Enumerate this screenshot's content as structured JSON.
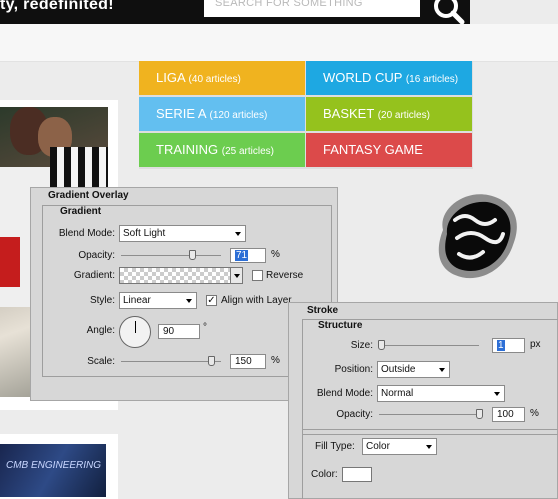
{
  "header": {
    "tagline": "ty, redefinited!",
    "search_placeholder": "SEARCH FOR SOMETHING"
  },
  "categories": [
    {
      "name": "LIGA",
      "count": "(40 articles)",
      "color": "#f0b31f"
    },
    {
      "name": "WORLD CUP",
      "count": "(16 articles)",
      "color": "#1ea8e2"
    },
    {
      "name": "SERIE A",
      "count": "(120 articles)",
      "color": "#63bff0"
    },
    {
      "name": "BASKET",
      "count": "(20 articles)",
      "color": "#95c21d"
    },
    {
      "name": "TRAINING",
      "count": "(25 articles)",
      "color": "#6ccd4f"
    },
    {
      "name": "FANTASY GAME",
      "count": "",
      "color": "#dc4a4a"
    }
  ],
  "thumb2_text": "CMB ENGINEERING",
  "gradient_overlay": {
    "title": "Gradient Overlay",
    "group": "Gradient",
    "blend_mode_label": "Blend Mode:",
    "blend_mode": "Soft Light",
    "opacity_label": "Opacity:",
    "opacity": "71",
    "opacity_fraction": 0.71,
    "percent": "%",
    "gradient_label": "Gradient:",
    "reverse_label": "Reverse",
    "reverse_checked": false,
    "style_label": "Style:",
    "style": "Linear",
    "align_label": "Align with Layer",
    "align_checked": true,
    "check_mark": "✓",
    "angle_label": "Angle:",
    "angle": "90",
    "degree": "°",
    "scale_label": "Scale:",
    "scale": "150",
    "scale_fraction": 0.9
  },
  "stroke": {
    "title": "Stroke",
    "group": "Structure",
    "size_label": "Size:",
    "size": "1",
    "size_fraction": 0.02,
    "px": "px",
    "position_label": "Position:",
    "position": "Outside",
    "blend_mode_label": "Blend Mode:",
    "blend_mode": "Normal",
    "opacity_label": "Opacity:",
    "opacity": "100",
    "opacity_fraction": 1.0,
    "percent": "%",
    "fill_type_label": "Fill Type:",
    "fill_type": "Color",
    "color_label": "Color:"
  },
  "colors": {
    "topbar": "#0f0f0f",
    "panel": "#d7d7d7"
  }
}
